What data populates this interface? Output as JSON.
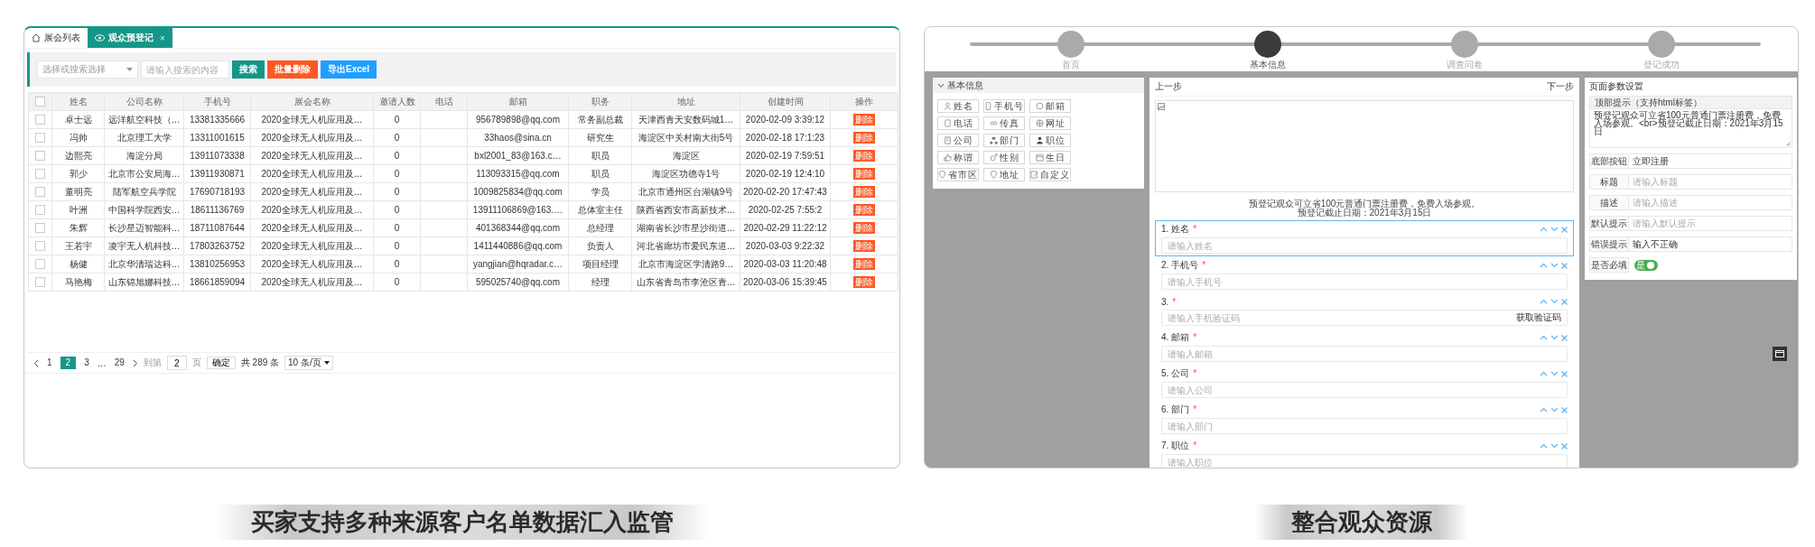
{
  "list_window": {
    "tabs": [
      {
        "label": "展会列表",
        "selected": false,
        "closable": false
      },
      {
        "label": "观众预登记",
        "selected": true,
        "closable": true,
        "close_label": "×"
      }
    ],
    "toolbar": {
      "select_placeholder": "选择或搜索选择",
      "search_placeholder": "请输入搜索的内容",
      "buttons": [
        {
          "label": "搜索",
          "kind": "primary"
        },
        {
          "label": "批量删除",
          "kind": "danger"
        },
        {
          "label": "导出Excel",
          "kind": "info"
        }
      ]
    },
    "table": {
      "header_checked": false,
      "columns": [
        "姓名",
        "公司名称",
        "手机号",
        "展会名称",
        "邀请人数",
        "电话",
        "邮箱",
        "职务",
        "地址",
        "创建时间",
        "操作"
      ],
      "rows": [
        {
          "checked": false,
          "cells": [
            "卓士远",
            "远洋航空科技（…",
            "13381335666",
            "2020全球无人机应用及…",
            "0",
            null,
            "956789898@qq.com",
            "常务副总裁",
            "天津西青天安数码城1…",
            "2020-02-09 3:39:12"
          ],
          "action": "删除"
        },
        {
          "checked": false,
          "cells": [
            "冯帅",
            "北京理工大学",
            "13311001615",
            "2020全球无人机应用及…",
            "0",
            null,
            "33haos@sina.cn",
            "研究生",
            "海淀区中关村南大街5号",
            "2020-02-18 17:1:23"
          ],
          "action": "删除"
        },
        {
          "checked": false,
          "cells": [
            "边熙亮",
            "海淀分局",
            "13911073338",
            "2020全球无人机应用及…",
            "0",
            null,
            "bxl2001_83@163.c…",
            "职员",
            "海淀区",
            "2020-02-19 7:59:51"
          ],
          "action": "删除"
        },
        {
          "checked": false,
          "cells": [
            "郭少",
            "北京市公安局海…",
            "13911930871",
            "2020全球无人机应用及…",
            "0",
            null,
            "113093315@qq.com",
            "职员",
            "海淀区功德寺1号",
            "2020-02-19 12:4:10"
          ],
          "action": "删除"
        },
        {
          "checked": false,
          "cells": [
            "董明亮",
            "陆军航空兵学院",
            "17690718193",
            "2020全球无人机应用及…",
            "0",
            null,
            "1009825834@qq.com",
            "学员",
            "北京市通州区台湖镇9号",
            "2020-02-20 17:47:43"
          ],
          "action": "删除"
        },
        {
          "checked": false,
          "cells": [
            "叶洲",
            "中国科学院西安…",
            "18611136769",
            "2020全球无人机应用及…",
            "0",
            null,
            "13911106869@163.…",
            "总体室主任",
            "陕西省西安市高新技术…",
            "2020-02-25 7:55:2"
          ],
          "action": "删除"
        },
        {
          "checked": false,
          "cells": [
            "朱辉",
            "长沙星迈智能科…",
            "18711087644",
            "2020全球无人机应用及…",
            "0",
            null,
            "401368344@qq.com",
            "总经理",
            "湖南省长沙市星沙街道…",
            "2020-02-29 11:22:12"
          ],
          "action": "删除"
        },
        {
          "checked": false,
          "cells": [
            "王若宇",
            "凌宇无人机科技…",
            "17803263752",
            "2020全球无人机应用及…",
            "0",
            null,
            "1411440886@qq.com",
            "负责人",
            "河北省廊坊市爱民东道…",
            "2020-03-03 9:22:32"
          ],
          "action": "删除"
        },
        {
          "checked": false,
          "cells": [
            "杨健",
            "北京华清瑞达科…",
            "13810256953",
            "2020全球无人机应用及…",
            "0",
            null,
            "yangjian@hqradar.c…",
            "项目经理",
            "北京市海淀区学清路9…",
            "2020-03-03 11:20:48"
          ],
          "action": "删除"
        },
        {
          "checked": false,
          "cells": [
            "马艳梅",
            "山东锦旭娜科技…",
            "18661859094",
            "2020全球无人机应用及…",
            "0",
            null,
            "595025740@qq.com",
            "经理",
            "山东省青岛市李沧区青…",
            "2020-03-06 15:39:45"
          ],
          "action": "删除"
        }
      ]
    },
    "pagination": {
      "pages": [
        {
          "kind": "page",
          "label": "1",
          "selected": false
        },
        {
          "kind": "page",
          "label": "2",
          "selected": true
        },
        {
          "kind": "page",
          "label": "3",
          "selected": false
        },
        {
          "kind": "ellipsis",
          "label": "…"
        },
        {
          "kind": "page",
          "label": "29",
          "selected": false
        }
      ],
      "goto_label": "到第",
      "goto_value": "2",
      "page_unit": "页",
      "confirm": "确定",
      "total": "共 289 条",
      "page_size": "10 条/页"
    }
  },
  "form_editor": {
    "steps": [
      {
        "label": "首页",
        "selected": false
      },
      {
        "label": "基本信息",
        "selected": true
      },
      {
        "label": "调查问卷",
        "selected": false
      },
      {
        "label": "登记成功",
        "selected": false
      }
    ],
    "field_palette": {
      "title": "基本信息",
      "expanded": true,
      "chips": [
        "姓名",
        "手机号",
        "邮箱",
        "电话",
        "传真",
        "网址",
        "公司",
        "部门",
        "职位",
        "称谓",
        "性别",
        "生日",
        "省市区",
        "地址",
        "自定义"
      ]
    },
    "preview": {
      "prev": "上一步",
      "next": "下一步",
      "tip_lines": [
        "预登记观众可立省100元普通门票注册费，免费入场参观。",
        "预登记截止日期：2021年3月15日"
      ],
      "fields": [
        {
          "label": "1. 姓名",
          "mark": "*",
          "placeholder": "请输入姓名",
          "selected": true
        },
        {
          "label": "2. 手机号",
          "mark": "*",
          "placeholder": "请输入手机号",
          "selected": false
        },
        {
          "label": "3.",
          "mark": "*",
          "placeholder": "请输入手机验证码",
          "action": "获取验证码",
          "selected": false
        },
        {
          "label": "4. 邮箱",
          "mark": "*",
          "placeholder": "请输入邮箱",
          "selected": false
        },
        {
          "label": "5. 公司",
          "mark": "*",
          "placeholder": "请输入公司",
          "selected": false
        },
        {
          "label": "6. 部门",
          "mark": "*",
          "placeholder": "请输入部门",
          "selected": false
        },
        {
          "label": "7. 职位",
          "mark": "*",
          "placeholder": "请输入职位",
          "selected": false
        }
      ]
    },
    "settings": {
      "title": "页面参数设置",
      "top_tip_label": "顶部提示（支持html标签）",
      "top_tip_value": "预登记观众可立省100元普通门票注册费，免费入场参观。<br>预登记截止日期：2021年3月15日",
      "rows": [
        {
          "kind": "input",
          "label": "底部按钮",
          "value": "立即注册"
        },
        {
          "kind": "input",
          "label": "标题",
          "placeholder": "请输入标题"
        },
        {
          "kind": "input",
          "label": "描述",
          "placeholder": "请输入描述"
        },
        {
          "kind": "input",
          "label": "默认提示",
          "placeholder": "请输入默认提示"
        },
        {
          "kind": "input",
          "label": "错误提示",
          "value": "输入不正确"
        },
        {
          "kind": "toggle",
          "label": "是否必填",
          "on": true,
          "text": "是"
        }
      ]
    }
  },
  "captions": [
    "买家支持多种来源客户名单数据汇入监管",
    "整合观众资源"
  ]
}
